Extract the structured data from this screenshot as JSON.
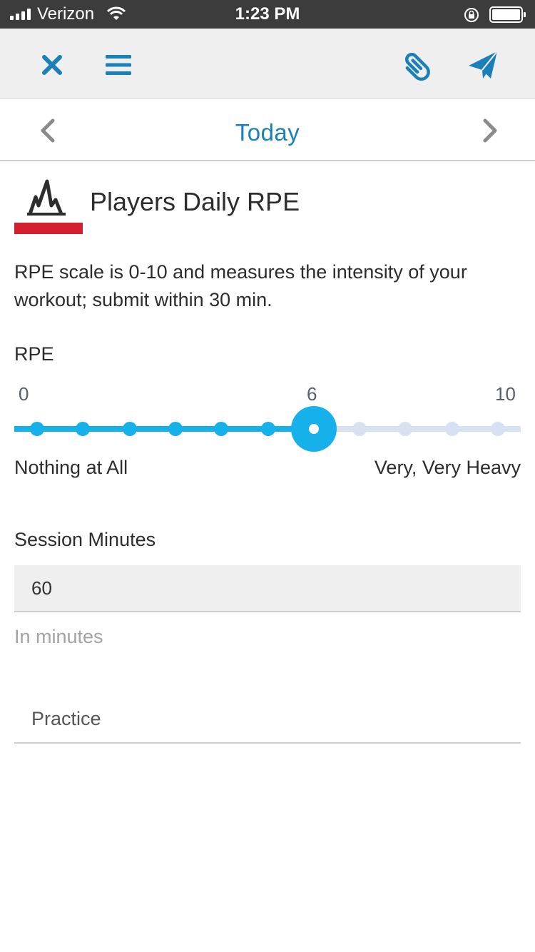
{
  "status_bar": {
    "carrier": "Verizon",
    "time": "1:23 PM"
  },
  "toolbar": {
    "close_icon": "close-icon",
    "menu_icon": "menu-icon",
    "attach_icon": "paperclip-icon",
    "send_icon": "send-icon",
    "accent_color": "#1b80b8"
  },
  "date_nav": {
    "title": "Today"
  },
  "form": {
    "title": "Players Daily RPE",
    "brand_color": "#d2202f",
    "description": "RPE scale is 0-10 and measures the intensity of your workout; submit within 30 min.",
    "rpe": {
      "label": "RPE",
      "min_label": "0",
      "max_label": "10",
      "value_label": "6",
      "value": 6,
      "min": 0,
      "max": 10,
      "low_text": "Nothing at All",
      "high_text": "Very, Very Heavy",
      "active_color": "#16b1ea",
      "inactive_color": "#d8e1f1"
    },
    "session_minutes": {
      "label": "Session Minutes",
      "value": "60",
      "helper": "In minutes"
    },
    "session_type": {
      "value": "Practice"
    }
  }
}
